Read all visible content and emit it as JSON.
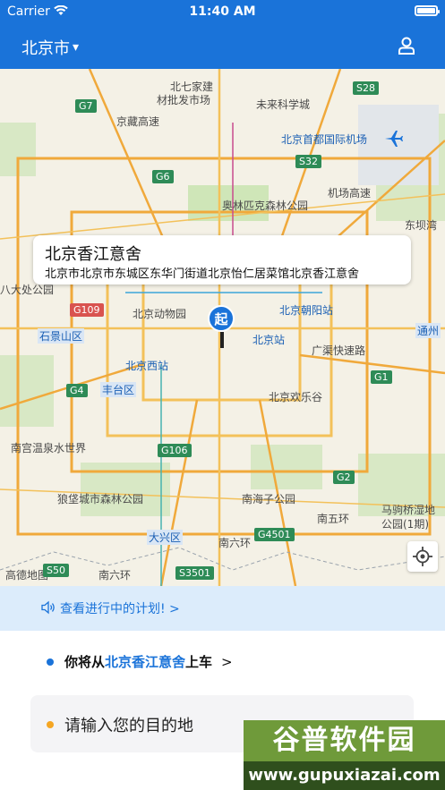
{
  "status_bar": {
    "carrier": "Carrier",
    "time": "11:40 AM"
  },
  "nav": {
    "city": "北京市",
    "city_arrow": "▾"
  },
  "map": {
    "labels": {
      "beiqijia": "北七家建",
      "beiqijia2": "材批发市场",
      "weilai": "未来科学城",
      "airport": "北京首都国际机场",
      "olympic": "奥林匹克森林公园",
      "zoo": "北京动物园",
      "chaoyang_station": "北京朝阳站",
      "beijing_station": "北京站",
      "west_station": "北京西站",
      "fengtai": "丰台区",
      "shijingshan": "石景山区",
      "happy_valley": "北京欢乐谷",
      "nanhaizi": "南海子公园",
      "langfa": "狼垡城市森林公园",
      "daxing": "大兴区",
      "nanliuhuan": "南六环",
      "majuqiao": "马驹桥湿地",
      "majuqiao2": "公园(1期)",
      "nangong": "南宫温泉水世界",
      "tongzhou": "通州",
      "dongba": "东坝湾",
      "guangqu": "广渠快速路",
      "nanwuhuan": "南五环",
      "nanliu2": "南六环",
      "jingcheng": "机场高速",
      "jingzang": "京藏高速",
      "badachu": "八大处公园",
      "gaomi": "高德地图"
    },
    "highways": [
      "G7",
      "G6",
      "S32",
      "S28",
      "G109",
      "G1",
      "G4",
      "G2",
      "G106",
      "G4501",
      "S3501",
      "S50"
    ],
    "popup": {
      "title": "北京香江意舍",
      "address": "北京市北京市东城区东华门街道北京怡仁居菜馆北京香江意舍"
    },
    "start_pin_label": "起"
  },
  "plan_banner": {
    "text": "查看进行中的计划! >"
  },
  "pickup": {
    "prefix": "你将从",
    "place": "北京香江意舍",
    "suffix": "上车",
    "arrow": ">"
  },
  "destination": {
    "placeholder": "请输入您的目的地"
  },
  "watermark": {
    "main": "谷普软件园",
    "url": "www.gupuxiazai.com"
  },
  "colors": {
    "accent": "#1a73d9",
    "orange": "#f5a623",
    "banner_bg": "#dcecfb"
  }
}
